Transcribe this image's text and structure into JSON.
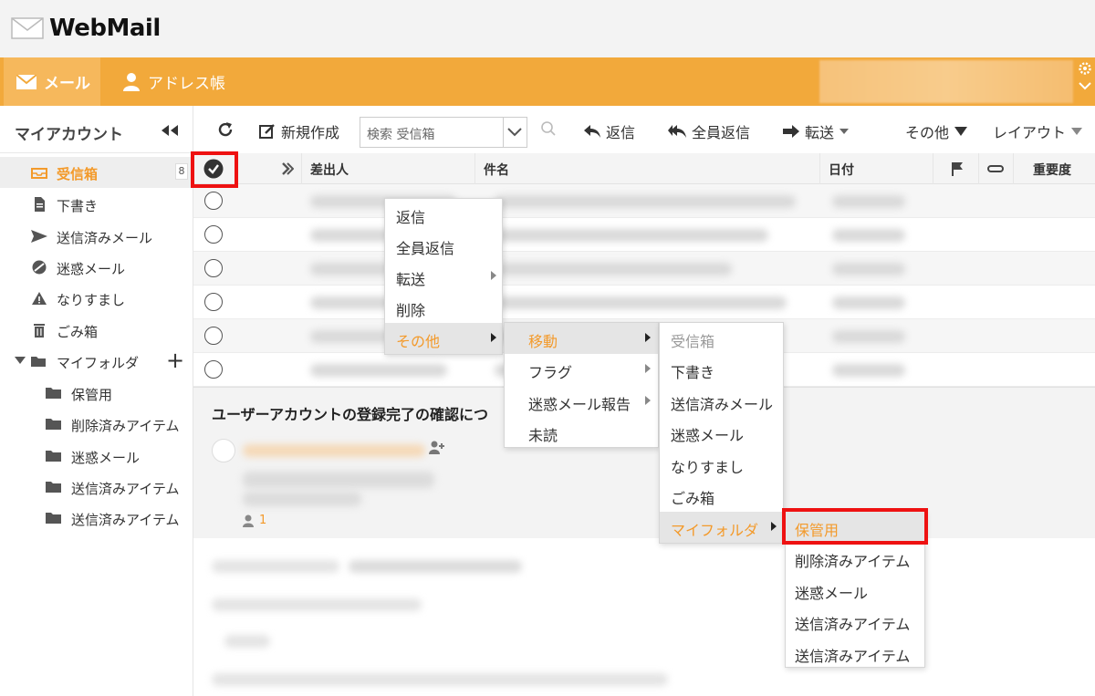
{
  "app": {
    "title": "WebMail"
  },
  "nav": {
    "mail": "メール",
    "address_book": "アドレス帳"
  },
  "sidebar": {
    "title": "マイアカウント",
    "items": [
      {
        "label": "受信箱",
        "badge": "8"
      },
      {
        "label": "下書き"
      },
      {
        "label": "送信済みメール"
      },
      {
        "label": "迷惑メール"
      },
      {
        "label": "なりすまし"
      },
      {
        "label": "ごみ箱"
      },
      {
        "label": "マイフォルダ"
      }
    ],
    "subfolders": [
      "保管用",
      "削除済みアイテム",
      "迷惑メール",
      "送信済みアイテム",
      "送信済みアイテム"
    ]
  },
  "toolbar": {
    "new": "新規作成",
    "search_placeholder": "検索 受信箱",
    "reply": "返信",
    "reply_all": "全員返信",
    "forward": "転送",
    "more": "その他",
    "layout": "レイアウト"
  },
  "list_header": {
    "sender": "差出人",
    "subject": "件名",
    "date": "日付",
    "importance": "重要度"
  },
  "preview": {
    "subject": "ユーザーアカウントの登録完了の確認につ",
    "recipient_count": "1"
  },
  "context_menu": {
    "items": [
      "返信",
      "全員返信",
      "転送",
      "削除",
      "その他"
    ],
    "more_submenu": [
      "移動",
      "フラグ",
      "迷惑メール報告",
      "未読"
    ],
    "move_submenu": [
      "受信箱",
      "下書き",
      "送信済みメール",
      "迷惑メール",
      "なりすまし",
      "ごみ箱",
      "マイフォルダ"
    ],
    "myfolder_submenu": [
      "保管用",
      "削除済みアイテム",
      "迷惑メール",
      "送信済みアイテム",
      "送信済みアイテム"
    ]
  },
  "colors": {
    "accent": "#f2a93b",
    "active_text": "#f39a2b",
    "highlight": "#ee1111"
  }
}
